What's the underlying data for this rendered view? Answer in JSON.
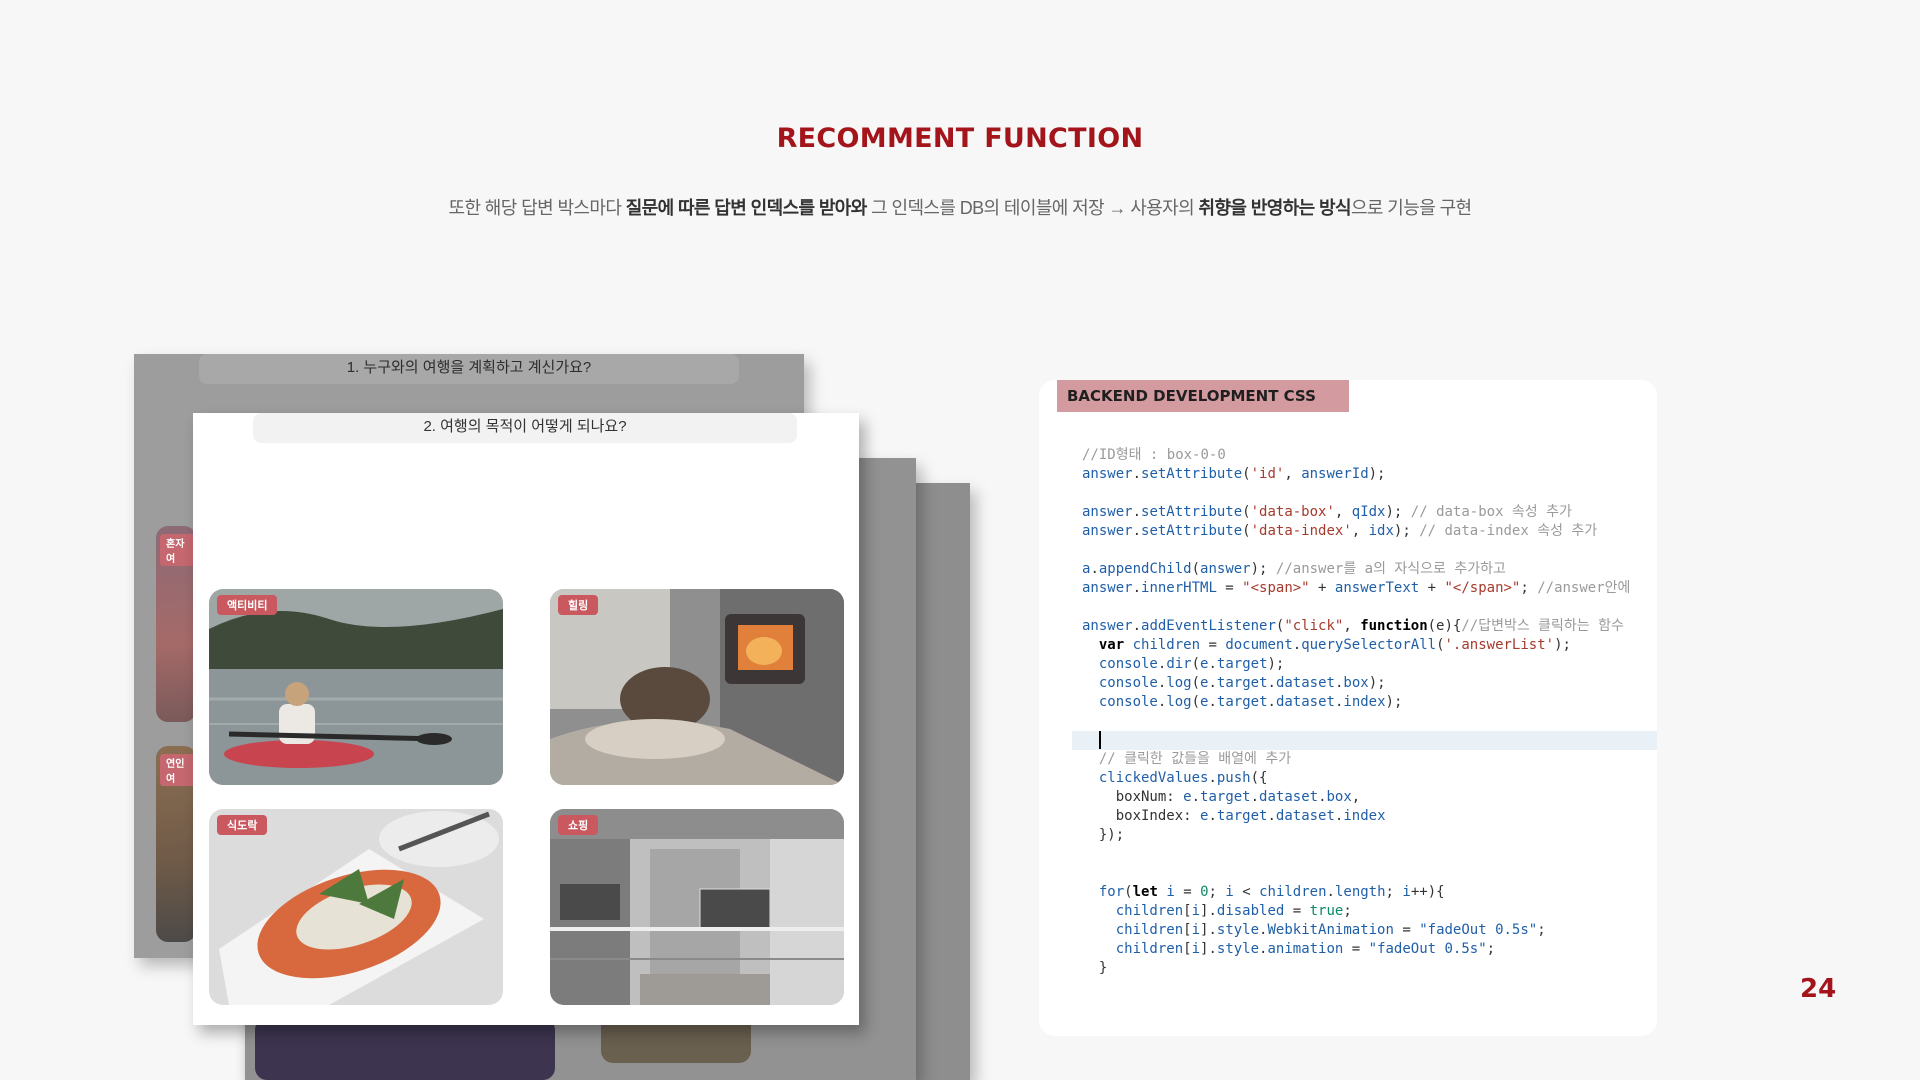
{
  "slide": {
    "title": "RECOMMENT FUNCTION",
    "subtitle": {
      "part1": "또한 해당 답변 박스마다 ",
      "bold1": "질문에 따른 답변 인덱스를 받아와",
      "part2": " 그 인덱스를 DB의 테이블에 저장  → 사용자의 ",
      "bold2": "취향을 반영하는 방식",
      "part3": "으로 기능을 구현"
    },
    "page_number": "24"
  },
  "screens": {
    "back_question": "1. 누구와의 여행을 계획하고 계신가요?",
    "back_tags": [
      "혼자여",
      "연인여"
    ],
    "front_question": "2. 여행의 목적이 어떻게 되나요?",
    "options": [
      {
        "tag": "액티비티",
        "icon": "kayak-photo"
      },
      {
        "tag": "힐링",
        "icon": "fireplace-photo"
      },
      {
        "tag": "식도락",
        "icon": "pasta-photo"
      },
      {
        "tag": "쇼핑",
        "icon": "mall-photo"
      }
    ]
  },
  "code_panel": {
    "badge": "BACKEND DEVELOPMENT  CSS"
  },
  "colors": {
    "accent": "#a3141b",
    "badge_bg": "#d39a9f",
    "tag_bg": "#c9595f"
  }
}
